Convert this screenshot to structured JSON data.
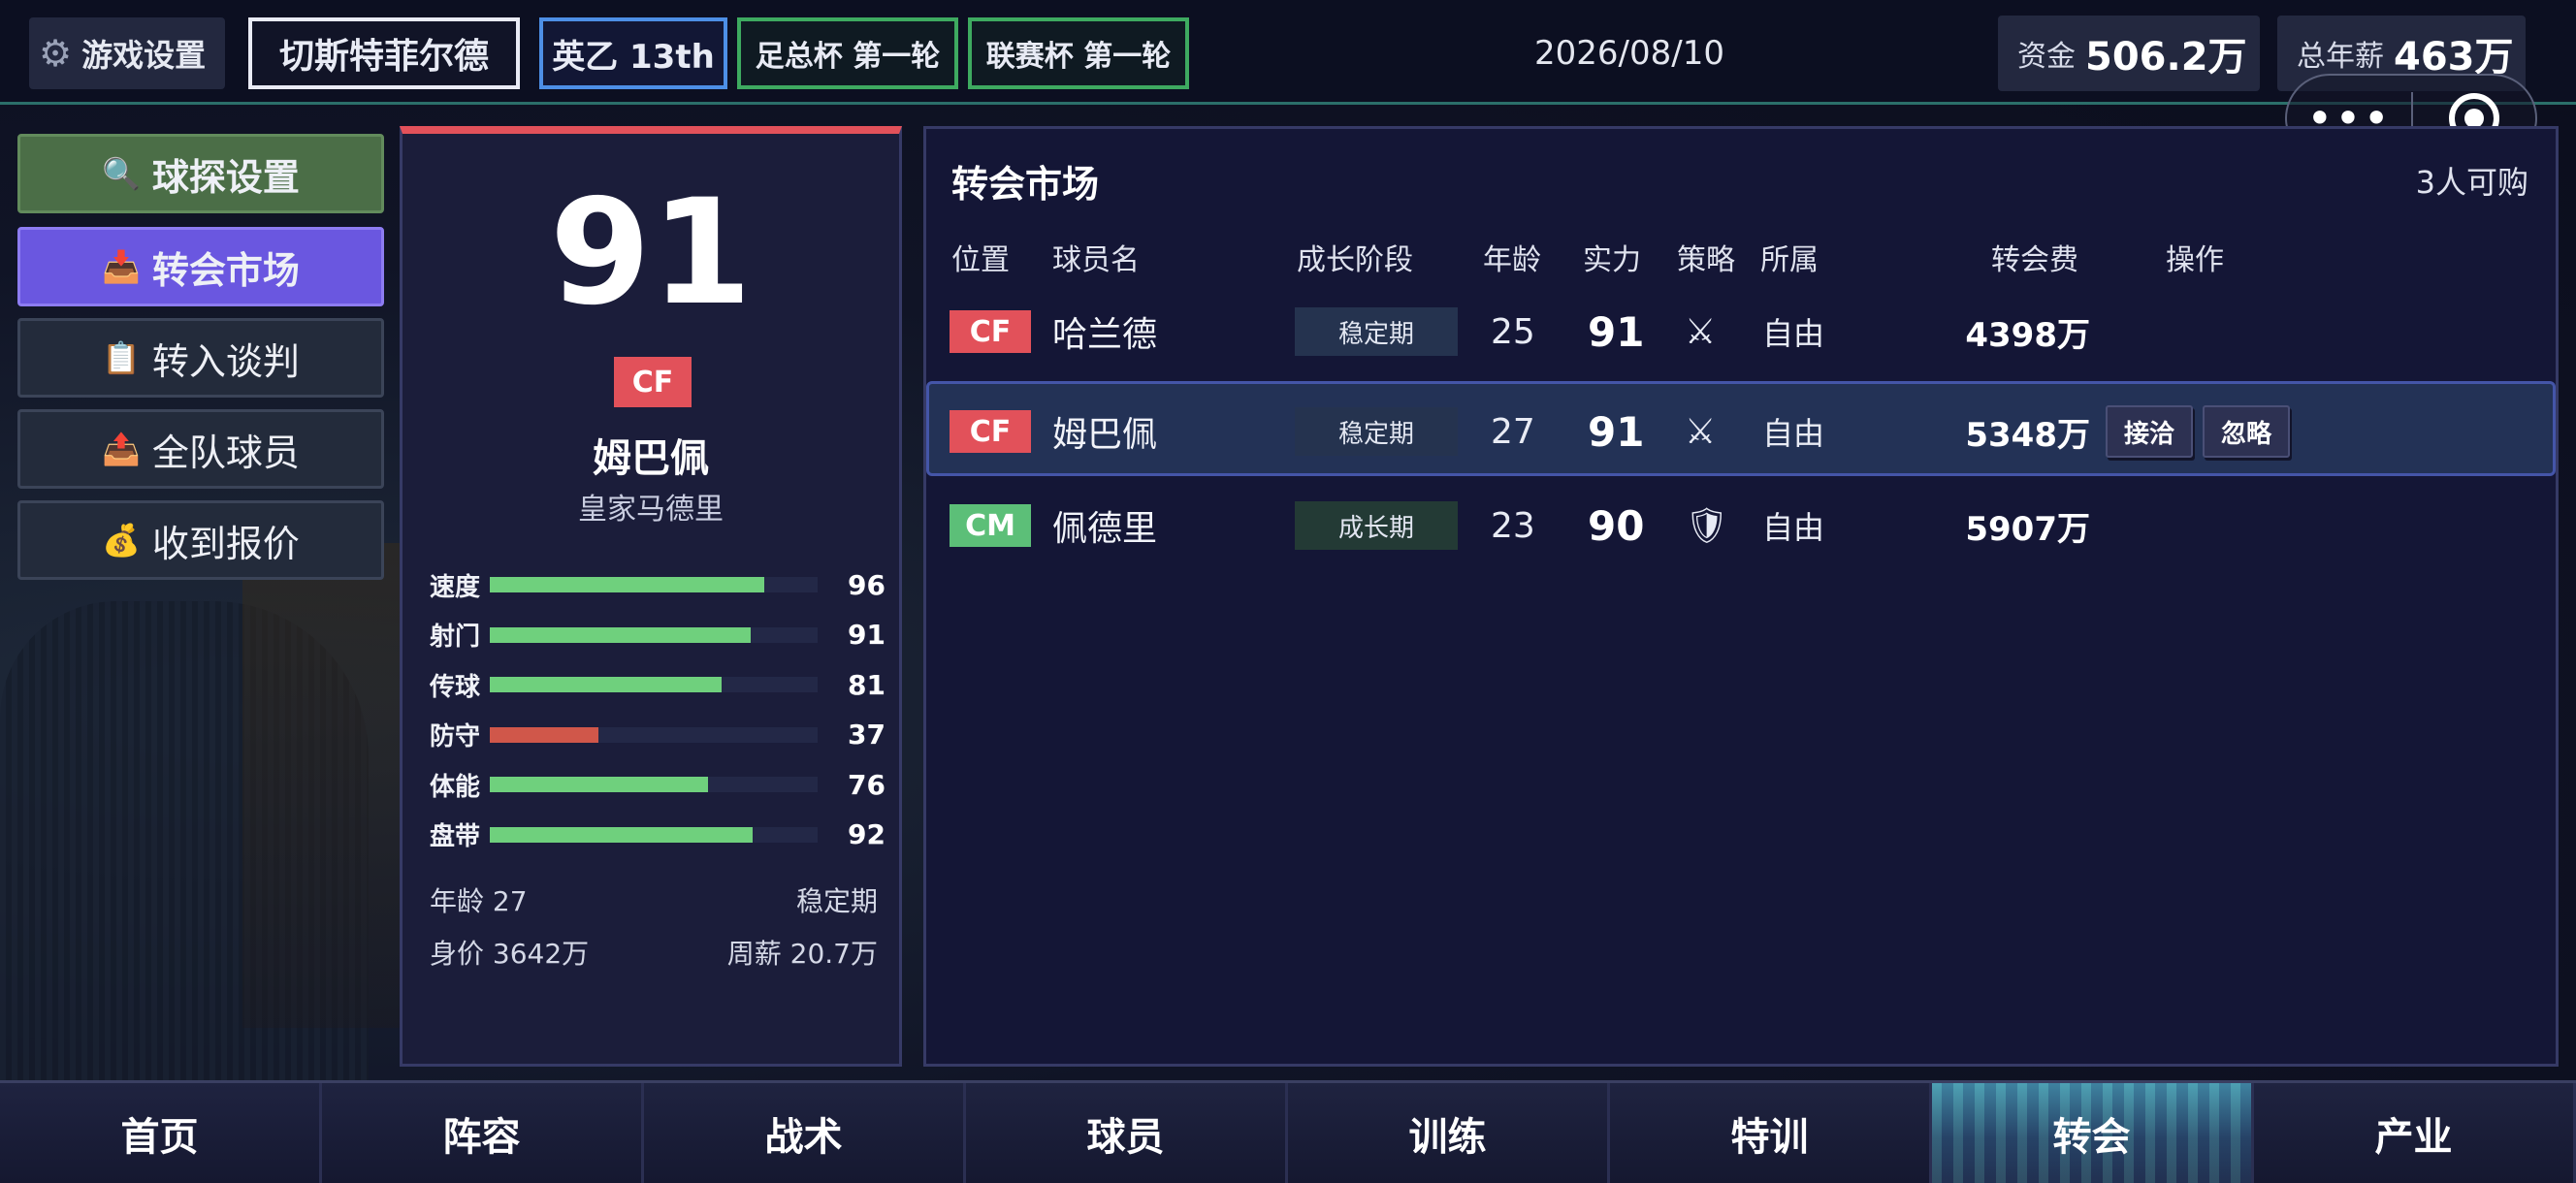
{
  "topbar": {
    "settings_label": "游戏设置",
    "club_name": "切斯特菲尔德",
    "league_label": "英乙 13th",
    "fa_cup_label": "足总杯 第一轮",
    "league_cup_label": "联赛杯 第一轮",
    "date": "2026/08/10",
    "funds_label": "资金",
    "funds_value": "506.2万",
    "wages_label": "总年薪",
    "wages_value": "463万",
    "capsule_dots": "•••"
  },
  "nav": {
    "scout": "球探设置",
    "market": "转会市场",
    "negotiation": "转入谈判",
    "squad": "全队球员",
    "offers": "收到报价"
  },
  "player_card": {
    "rating": "91",
    "position": "CF",
    "name": "姆巴佩",
    "club": "皇家马德里",
    "stats": [
      {
        "label": "速度",
        "value": 96
      },
      {
        "label": "射门",
        "value": 91
      },
      {
        "label": "传球",
        "value": 81
      },
      {
        "label": "防守",
        "value": 37
      },
      {
        "label": "体能",
        "value": 76
      },
      {
        "label": "盘带",
        "value": 92
      }
    ],
    "age_text": "年龄 27",
    "stage_text": "稳定期",
    "value_text": "身价 3642万",
    "wage_text": "周薪 20.7万"
  },
  "market": {
    "title": "转会市场",
    "available": "3人可购",
    "headers": {
      "position": "位置",
      "name": "球员名",
      "stage": "成长阶段",
      "age": "年龄",
      "power": "实力",
      "tactic": "策略",
      "owner": "所属",
      "fee": "转会费",
      "action": "操作"
    },
    "rows": [
      {
        "position": "CF",
        "pos_color": "#e2515a",
        "name": "哈兰德",
        "stage": "稳定期",
        "age": "25",
        "power": "91",
        "tactic_icon": "crossed-swords-icon",
        "tactic": "⚔",
        "owner": "自由",
        "fee": "4398万"
      },
      {
        "position": "CF",
        "pos_color": "#e2515a",
        "name": "姆巴佩",
        "stage": "稳定期",
        "age": "27",
        "power": "91",
        "tactic_icon": "crossed-swords-icon",
        "tactic": "⚔",
        "owner": "自由",
        "fee": "5348万",
        "selected": true,
        "contact": "接洽",
        "ignore": "忽略"
      },
      {
        "position": "CM",
        "pos_color": "#5cbf78",
        "name": "佩德里",
        "stage": "成长期",
        "age": "23",
        "power": "90",
        "tactic_icon": "shield-icon",
        "tactic": "🛡",
        "owner": "自由",
        "fee": "5907万"
      }
    ]
  },
  "tabs": [
    {
      "label": "首页"
    },
    {
      "label": "阵容"
    },
    {
      "label": "战术"
    },
    {
      "label": "球员"
    },
    {
      "label": "训练"
    },
    {
      "label": "特训"
    },
    {
      "label": "转会",
      "active": true
    },
    {
      "label": "产业"
    }
  ]
}
